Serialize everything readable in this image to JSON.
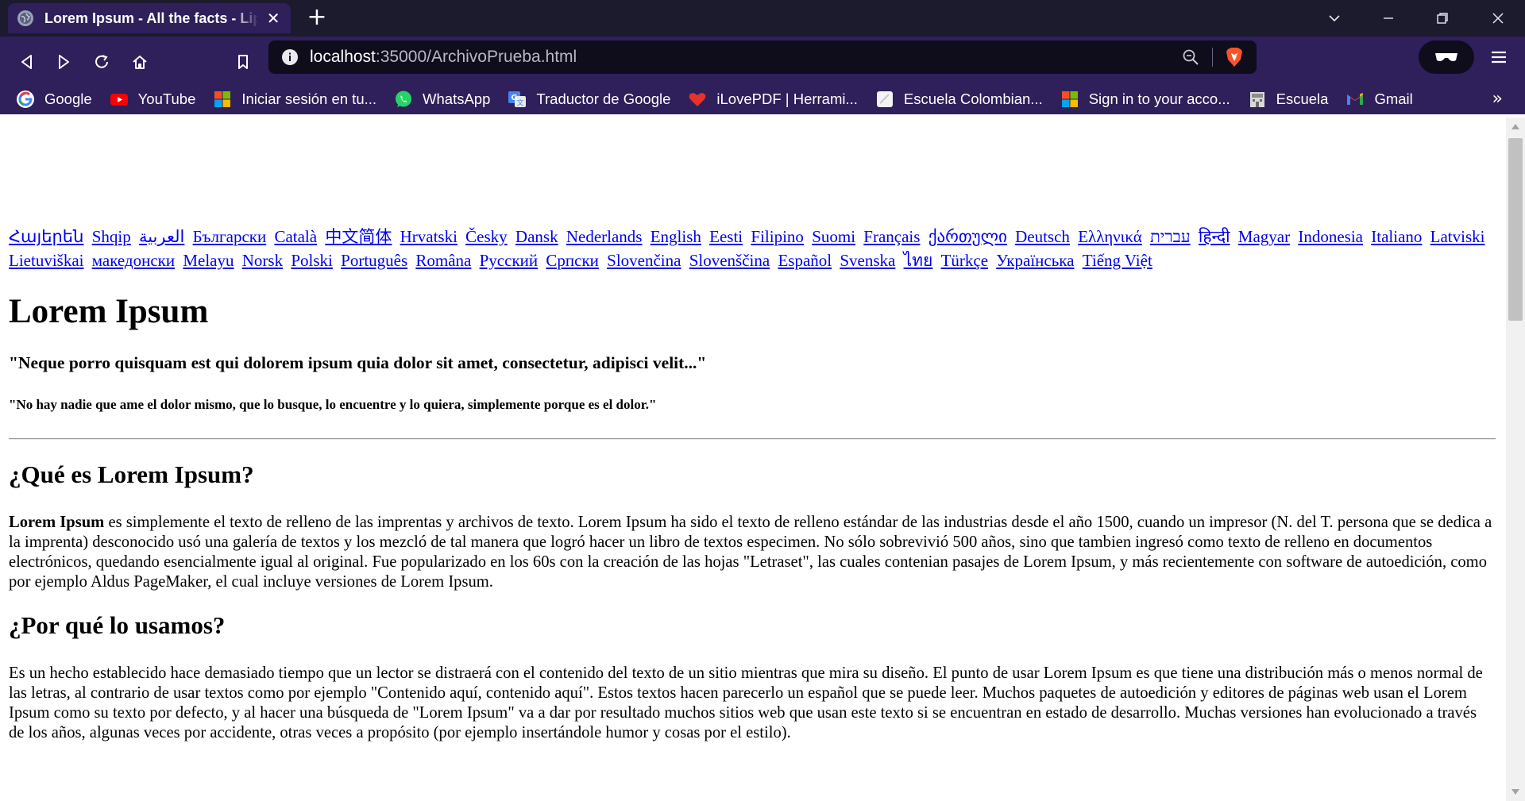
{
  "browser": {
    "tab_title": "Lorem Ipsum - All the facts - Lipsum generator",
    "url_host": "localhost",
    "url_path": ":35000/ArchivoPrueba.html"
  },
  "bookmarks": [
    {
      "label": "Google",
      "icon": "google-icon"
    },
    {
      "label": "YouTube",
      "icon": "youtube-icon"
    },
    {
      "label": "Iniciar sesión en tu...",
      "icon": "microsoft-icon"
    },
    {
      "label": "WhatsApp",
      "icon": "whatsapp-icon"
    },
    {
      "label": "Traductor de Google",
      "icon": "google-translate-icon"
    },
    {
      "label": "iLovePDF | Herrami...",
      "icon": "ilovepdf-icon"
    },
    {
      "label": "Escuela Colombian...",
      "icon": "document-icon"
    },
    {
      "label": "Sign in to your acco...",
      "icon": "microsoft-icon"
    },
    {
      "label": "Escuela",
      "icon": "building-icon"
    },
    {
      "label": "Gmail",
      "icon": "gmail-icon"
    }
  ],
  "page": {
    "languages": [
      "Հայերեն",
      "Shqip",
      "العربية",
      "Български",
      "Català",
      "中文简体",
      "Hrvatski",
      "Česky",
      "Dansk",
      "Nederlands",
      "English",
      "Eesti",
      "Filipino",
      "Suomi",
      "Français",
      "ქართული",
      "Deutsch",
      "Ελληνικά",
      "עברית",
      "हिन्दी",
      "Magyar",
      "Indonesia",
      "Italiano",
      "Latviski",
      "Lietuviškai",
      "македонски",
      "Melayu",
      "Norsk",
      "Polski",
      "Português",
      "Româna",
      "Pyccкий",
      "Српски",
      "Slovenčina",
      "Slovenščina",
      "Español",
      "Svenska",
      "ไทย",
      "Türkçe",
      "Українська",
      "Tiếng Việt"
    ],
    "title": "Lorem Ipsum",
    "quote_latin": "\"Neque porro quisquam est qui dolorem ipsum quia dolor sit amet, consectetur, adipisci velit...\"",
    "quote_spanish": "\"No hay nadie que ame el dolor mismo, que lo busque, lo encuentre y lo quiera, simplemente porque es el dolor.\"",
    "section1_heading": "¿Qué es Lorem Ipsum?",
    "section1_bold": "Lorem Ipsum",
    "section1_text": " es simplemente el texto de relleno de las imprentas y archivos de texto. Lorem Ipsum ha sido el texto de relleno estándar de las industrias desde el año 1500, cuando un impresor (N. del T. persona que se dedica a la imprenta) desconocido usó una galería de textos y los mezcló de tal manera que logró hacer un libro de textos especimen. No sólo sobrevivió 500 años, sino que tambien ingresó como texto de relleno en documentos electrónicos, quedando esencialmente igual al original. Fue popularizado en los 60s con la creación de las hojas \"Letraset\", las cuales contenian pasajes de Lorem Ipsum, y más recientemente con software de autoedición, como por ejemplo Aldus PageMaker, el cual incluye versiones de Lorem Ipsum.",
    "section2_heading": "¿Por qué lo usamos?",
    "section2_text": "Es un hecho establecido hace demasiado tiempo que un lector se distraerá con el contenido del texto de un sitio mientras que mira su diseño. El punto de usar Lorem Ipsum es que tiene una distribución más o menos normal de las letras, al contrario de usar textos como por ejemplo \"Contenido aquí, contenido aquí\". Estos textos hacen parecerlo un español que se puede leer. Muchos paquetes de autoedición y editores de páginas web usan el Lorem Ipsum como su texto por defecto, y al hacer una búsqueda de \"Lorem Ipsum\" va a dar por resultado muchos sitios web que usan este texto si se encuentran en estado de desarrollo. Muchas versiones han evolucionado a través de los años, algunas veces por accidente, otras veces a propósito (por ejemplo insertándole humor y cosas por el estilo)."
  },
  "colors": {
    "tabstrip": "#1c1b2e",
    "toolbar": "#2f1f5a",
    "urlbar": "#0f0d1c",
    "link": "#0000ee"
  }
}
